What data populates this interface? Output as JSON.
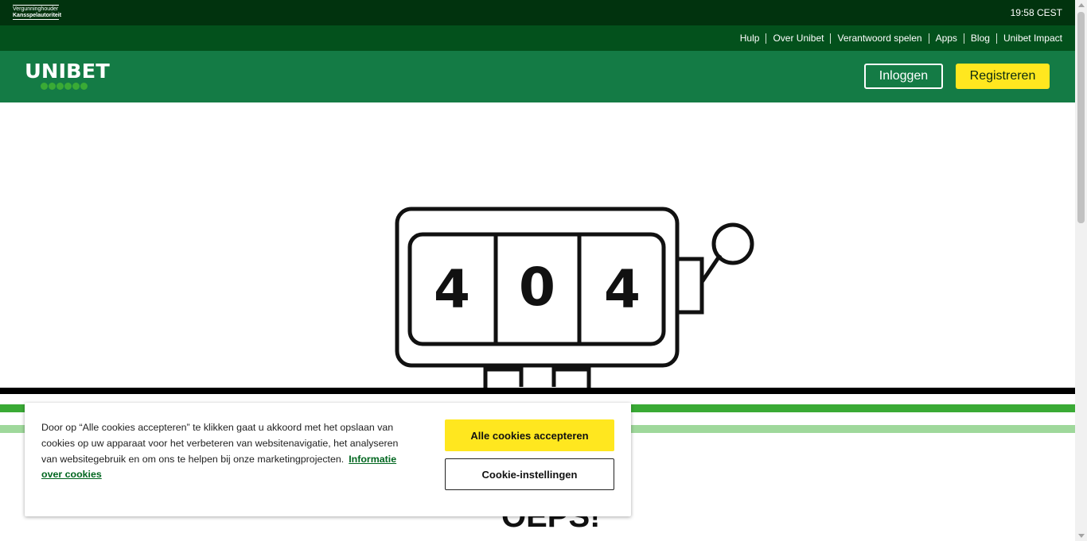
{
  "topbar": {
    "license_line1": "Vergunninghouder",
    "license_line2": "Kansspelautoriteit",
    "time": "19:58 CEST"
  },
  "nav": {
    "links": [
      "Hulp",
      "Over Unibet",
      "Verantwoord spelen",
      "Apps",
      "Blog",
      "Unibet Impact"
    ]
  },
  "header": {
    "logo_text": "UNIBET",
    "login_label": "Inloggen",
    "register_label": "Registreren"
  },
  "hero": {
    "digits": [
      "4",
      "0",
      "4"
    ],
    "partial_heading": "OEPS!"
  },
  "cookie": {
    "text": "Door op “Alle cookies accepteren” te klikken gaat u akkoord met het opslaan van cookies op uw apparaat voor het verbeteren van websitenavigatie, het analyseren van websitegebruik en om ons te helpen bij onze marketingprojecten.",
    "link_label": "Informatie over cookies",
    "accept_label": "Alle cookies accepteren",
    "settings_label": "Cookie-instellingen"
  },
  "colors": {
    "top_bar": "#01330e",
    "nav_bar": "#03511c",
    "header": "#147b45",
    "accent_yellow": "#ffe71f",
    "green_line": "#3aaa35",
    "light_green_line": "#9fd89b"
  }
}
